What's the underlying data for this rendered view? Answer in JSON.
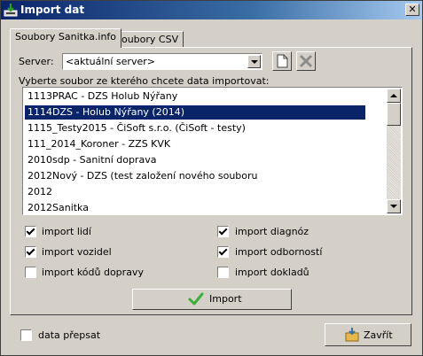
{
  "window": {
    "title": "Import dat",
    "close_glyph": "✕"
  },
  "tabs": [
    {
      "label": "Soubory Sanitka.info",
      "active": true
    },
    {
      "label": "Soubory CSV",
      "active": false
    }
  ],
  "server": {
    "label": "Server:",
    "value": "<aktuální server>"
  },
  "list": {
    "label": "Vyberte soubor ze kterého chcete data importovat:",
    "items": [
      "1113PRAC - DZS Holub Nýřany",
      "1114DZS - Holub Nýřany (2014)",
      "1115_Testy2015 - ČiSoft s.r.o. (ČiSoft - testy)",
      "111_2014_Koroner - ZZS KVK",
      "2010sdp - Sanitní doprava",
      "2012Nový - DZS (test založení nového souboru",
      "2012",
      "2012Sanitka"
    ],
    "selected_index": 1
  },
  "options": {
    "import_lidi": {
      "label": "import lidí",
      "checked": true
    },
    "import_vozidel": {
      "label": "import vozidel",
      "checked": true
    },
    "import_kodu_dopravy": {
      "label": "import kódů dopravy",
      "checked": false
    },
    "import_diagnoz": {
      "label": "import diagnóz",
      "checked": true
    },
    "import_odbornosti": {
      "label": "import odborností",
      "checked": true
    },
    "import_dokladu": {
      "label": "import dokladů",
      "checked": false
    }
  },
  "import_button": {
    "label": "Import",
    "icon": "checkmark-icon"
  },
  "data_prepsat": {
    "label": "data přepsat",
    "checked": false
  },
  "close_button": {
    "label": "Zavřít",
    "icon": "exit-icon"
  },
  "colors": {
    "title_bar": "#0a246a",
    "selection": "#0a246a",
    "face": "#d4d0c8"
  }
}
